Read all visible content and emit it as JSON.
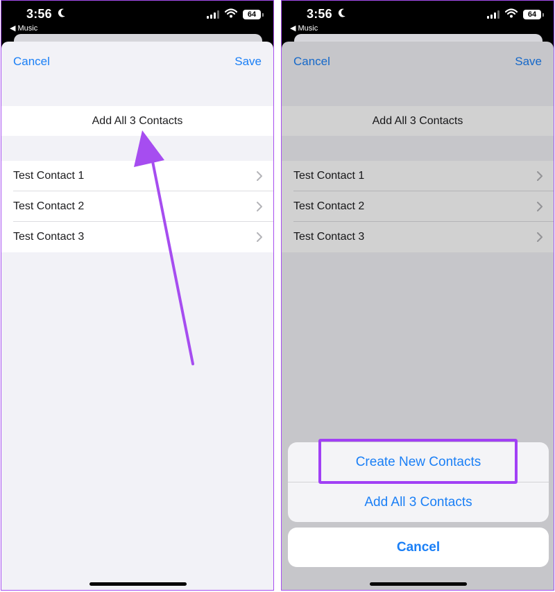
{
  "status_bar": {
    "time": "3:56",
    "back_app": "◀ Music",
    "battery": "64"
  },
  "nav": {
    "cancel": "Cancel",
    "save": "Save"
  },
  "form": {
    "add_all": "Add All 3 Contacts",
    "contacts": [
      "Test Contact 1",
      "Test Contact 2",
      "Test Contact 3"
    ]
  },
  "action_sheet": {
    "create": "Create New Contacts",
    "add_all": "Add All 3 Contacts",
    "cancel": "Cancel"
  },
  "colors": {
    "accent": "#1a7ff6",
    "annotation": "#a64df0"
  }
}
